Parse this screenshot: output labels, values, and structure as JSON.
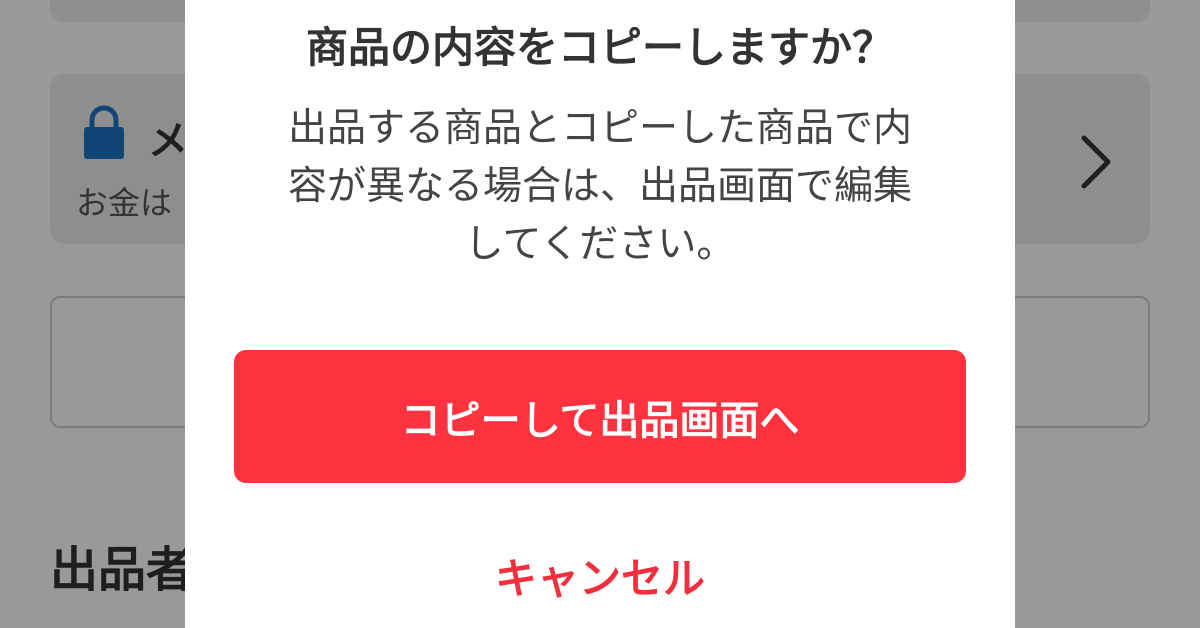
{
  "background_page": {
    "secure_card": {
      "title": "メ",
      "subtitle": "お金は"
    },
    "section_heading": "出品者"
  },
  "dialog": {
    "title": "商品の内容をコピーしますか？",
    "message_lines": [
      "出品する商品とコピーした商品で内",
      "容が異なる場合は、出品画面で編集",
      "してください。"
    ],
    "primary_button": "コピーして出品画面へ",
    "cancel_button": "キャンセル"
  },
  "colors": {
    "primary": "#ff333f",
    "cancel_text": "#f2303d",
    "lock_icon": "#1b73c4"
  }
}
